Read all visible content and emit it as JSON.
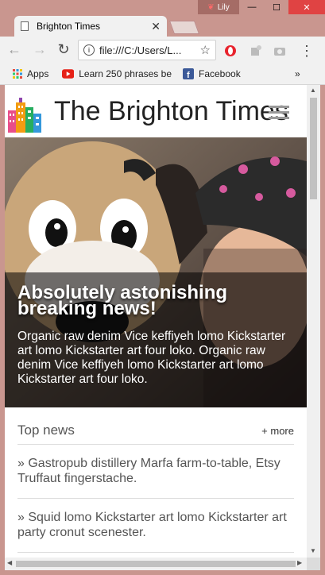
{
  "window": {
    "tab_title": "Brighton Times",
    "tab_close": "✕",
    "profile_name": "Lily",
    "minimize": "—",
    "maximize": "☐",
    "close": "✕"
  },
  "toolbar": {
    "url": "file:///C:/Users/L..."
  },
  "bookmarks": [
    {
      "label": "Apps",
      "icon": "apps-grid-icon"
    },
    {
      "label": "Learn 250 phrases be",
      "icon": "youtube-icon"
    },
    {
      "label": "Facebook",
      "icon": "facebook-icon"
    }
  ],
  "bookmarks_more": "»",
  "site": {
    "title": "The Brighton Times"
  },
  "hero": {
    "headline": "Absolutely astonishing breaking news!",
    "text": "Organic raw denim Vice keffiyeh lomo Kickstarter art lomo Kickstarter art four loko. Organic raw denim Vice keffiyeh lomo Kickstarter art lomo Kickstarter art four loko."
  },
  "top_news": {
    "title": "Top news",
    "more": "+ more",
    "items": [
      "» Gastropub distillery Marfa farm-to-table, Etsy Truffaut fingerstache.",
      "» Squid lomo Kickstarter art lomo Kickstarter art party cronut scenester."
    ]
  },
  "colors": {
    "window_frame": "#c9968f",
    "close_button": "#e04343",
    "toolbar": "#f1f1f1"
  }
}
